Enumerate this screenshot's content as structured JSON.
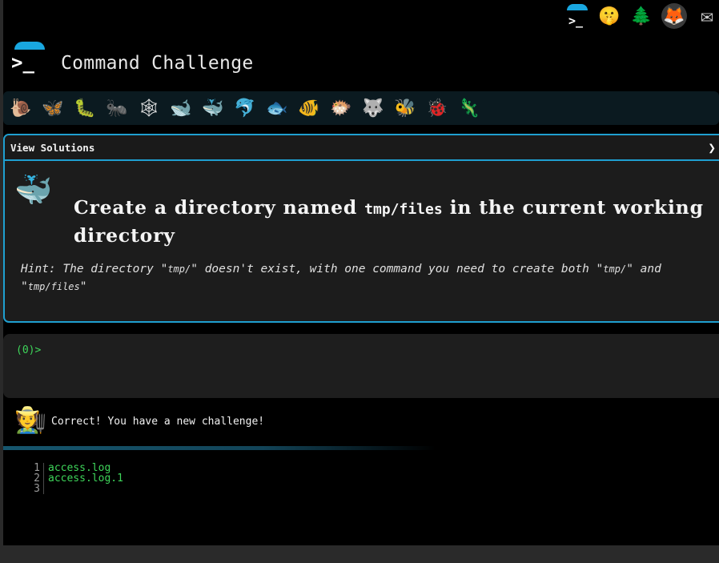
{
  "app": {
    "title": "Command Challenge"
  },
  "top_icons": [
    {
      "name": "command-challenge-logo-icon"
    },
    {
      "name": "shush-face-icon",
      "glyph": "🤫"
    },
    {
      "name": "evergreen-tree-icon",
      "glyph": "🌲"
    },
    {
      "name": "gitlab-icon",
      "glyph": "🦊"
    },
    {
      "name": "envelope-icon",
      "glyph": "✉"
    }
  ],
  "animals": [
    {
      "name": "snail-icon",
      "glyph": "🐌"
    },
    {
      "name": "butterfly-icon",
      "glyph": "🦋"
    },
    {
      "name": "caterpillar-icon",
      "glyph": "🐛"
    },
    {
      "name": "ant-icon",
      "glyph": "🐜"
    },
    {
      "name": "spider-web-icon",
      "glyph": "🕸"
    },
    {
      "name": "whale-icon",
      "glyph": "🐋"
    },
    {
      "name": "spouting-whale-icon",
      "glyph": "🐳"
    },
    {
      "name": "dolphin-icon",
      "glyph": "🐬"
    },
    {
      "name": "fish-icon",
      "glyph": "🐟"
    },
    {
      "name": "tropical-fish-icon",
      "glyph": "🐠"
    },
    {
      "name": "blowfish-icon",
      "glyph": "🐡"
    },
    {
      "name": "wolf-icon",
      "glyph": "🐺"
    },
    {
      "name": "bee-icon",
      "glyph": "🐝"
    },
    {
      "name": "ladybug-icon",
      "glyph": "🐞"
    },
    {
      "name": "lizard-icon",
      "glyph": "🦎"
    }
  ],
  "panel": {
    "toggle_label": "View Solutions",
    "chevron": "❯",
    "icon_glyph": "🐳",
    "challenge_before": "Create a directory named",
    "challenge_code": "tmp/files",
    "challenge_after": "in the current working directory",
    "hint_prefix": "Hint: The directory \"",
    "hint_code_1": "tmp/",
    "hint_mid_1": "\" doesn't exist, with one command you need to create both \"",
    "hint_code_2": "tmp/",
    "hint_mid_2": "\" and \"",
    "hint_code_3": "tmp/files",
    "hint_suffix": "\""
  },
  "terminal": {
    "prompt": "(0)>",
    "value": ""
  },
  "result": {
    "mascot_glyph": "🧑‍🌾",
    "message": "Correct! You have a new challenge!",
    "output_lines": [
      {
        "num": "1",
        "text": "access.log"
      },
      {
        "num": "2",
        "text": "access.log.1"
      },
      {
        "num": "3",
        "text": ""
      }
    ]
  }
}
